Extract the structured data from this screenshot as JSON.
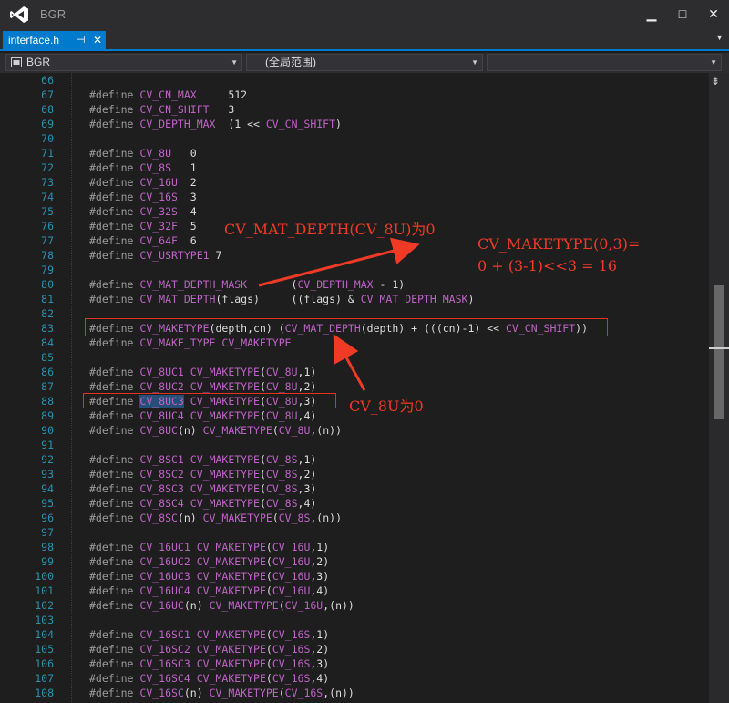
{
  "app": {
    "title": "BGR"
  },
  "window_controls": {
    "minimize": "▁",
    "maximize": "□",
    "close": "✕"
  },
  "tab": {
    "label": "interface.h",
    "pin": "⊣",
    "close": "✕",
    "menu": "▼"
  },
  "navbar": {
    "project": "BGR",
    "scope": "(全局范围)",
    "member": ""
  },
  "scrollbar": {
    "split_icon": "⇟"
  },
  "code_lines": [
    {
      "num": "66",
      "parts": []
    },
    {
      "num": "67",
      "parts": [
        [
          "kw",
          "#define "
        ],
        [
          "m",
          "CV_CN_MAX"
        ],
        [
          "p",
          "     512"
        ]
      ]
    },
    {
      "num": "68",
      "parts": [
        [
          "kw",
          "#define "
        ],
        [
          "m",
          "CV_CN_SHIFT"
        ],
        [
          "p",
          "   3"
        ]
      ]
    },
    {
      "num": "69",
      "parts": [
        [
          "kw",
          "#define "
        ],
        [
          "m",
          "CV_DEPTH_MAX"
        ],
        [
          "p",
          "  (1 << "
        ],
        [
          "m",
          "CV_CN_SHIFT"
        ],
        [
          "p",
          ")"
        ]
      ]
    },
    {
      "num": "70",
      "parts": []
    },
    {
      "num": "71",
      "parts": [
        [
          "kw",
          "#define "
        ],
        [
          "m",
          "CV_8U"
        ],
        [
          "p",
          "   0"
        ]
      ]
    },
    {
      "num": "72",
      "parts": [
        [
          "kw",
          "#define "
        ],
        [
          "m",
          "CV_8S"
        ],
        [
          "p",
          "   1"
        ]
      ]
    },
    {
      "num": "73",
      "parts": [
        [
          "kw",
          "#define "
        ],
        [
          "m",
          "CV_16U"
        ],
        [
          "p",
          "  2"
        ]
      ]
    },
    {
      "num": "74",
      "parts": [
        [
          "kw",
          "#define "
        ],
        [
          "m",
          "CV_16S"
        ],
        [
          "p",
          "  3"
        ]
      ]
    },
    {
      "num": "75",
      "parts": [
        [
          "kw",
          "#define "
        ],
        [
          "m",
          "CV_32S"
        ],
        [
          "p",
          "  4"
        ]
      ]
    },
    {
      "num": "76",
      "parts": [
        [
          "kw",
          "#define "
        ],
        [
          "m",
          "CV_32F"
        ],
        [
          "p",
          "  5"
        ]
      ]
    },
    {
      "num": "77",
      "parts": [
        [
          "kw",
          "#define "
        ],
        [
          "m",
          "CV_64F"
        ],
        [
          "p",
          "  6"
        ]
      ]
    },
    {
      "num": "78",
      "parts": [
        [
          "kw",
          "#define "
        ],
        [
          "m",
          "CV_USRTYPE1"
        ],
        [
          "p",
          " 7"
        ]
      ]
    },
    {
      "num": "79",
      "parts": []
    },
    {
      "num": "80",
      "parts": [
        [
          "kw",
          "#define "
        ],
        [
          "m",
          "CV_MAT_DEPTH_MASK"
        ],
        [
          "p",
          "       ("
        ],
        [
          "m",
          "CV_DEPTH_MAX"
        ],
        [
          "p",
          " - 1)"
        ]
      ]
    },
    {
      "num": "81",
      "parts": [
        [
          "kw",
          "#define "
        ],
        [
          "m",
          "CV_MAT_DEPTH"
        ],
        [
          "p",
          "(flags)     ((flags) & "
        ],
        [
          "m",
          "CV_MAT_DEPTH_MASK"
        ],
        [
          "p",
          ")"
        ]
      ]
    },
    {
      "num": "82",
      "parts": []
    },
    {
      "num": "83",
      "parts": [
        [
          "kw",
          "#define "
        ],
        [
          "m",
          "CV_MAKETYPE"
        ],
        [
          "p",
          "(depth,cn) ("
        ],
        [
          "m",
          "CV_MAT_DEPTH"
        ],
        [
          "p",
          "(depth) + (((cn)-1) << "
        ],
        [
          "m",
          "CV_CN_SHIFT"
        ],
        [
          "p",
          "))"
        ]
      ]
    },
    {
      "num": "84",
      "parts": [
        [
          "kw",
          "#define "
        ],
        [
          "m",
          "CV_MAKE_TYPE"
        ],
        [
          "p",
          " "
        ],
        [
          "m",
          "CV_MAKETYPE"
        ]
      ]
    },
    {
      "num": "85",
      "parts": []
    },
    {
      "num": "86",
      "parts": [
        [
          "kw",
          "#define "
        ],
        [
          "m",
          "CV_8UC1"
        ],
        [
          "p",
          " "
        ],
        [
          "m",
          "CV_MAKETYPE"
        ],
        [
          "p",
          "("
        ],
        [
          "m",
          "CV_8U"
        ],
        [
          "p",
          ",1)"
        ]
      ]
    },
    {
      "num": "87",
      "parts": [
        [
          "kw",
          "#define "
        ],
        [
          "m",
          "CV_8UC2"
        ],
        [
          "p",
          " "
        ],
        [
          "m",
          "CV_MAKETYPE"
        ],
        [
          "p",
          "("
        ],
        [
          "m",
          "CV_8U"
        ],
        [
          "p",
          ",2)"
        ]
      ]
    },
    {
      "num": "88",
      "parts": [
        [
          "kw",
          "#define "
        ],
        [
          "mh",
          "CV_8UC3"
        ],
        [
          "p",
          " "
        ],
        [
          "m",
          "CV_MAKETYPE"
        ],
        [
          "p",
          "("
        ],
        [
          "m",
          "CV_8U"
        ],
        [
          "p",
          ",3)"
        ]
      ]
    },
    {
      "num": "89",
      "parts": [
        [
          "kw",
          "#define "
        ],
        [
          "m",
          "CV_8UC4"
        ],
        [
          "p",
          " "
        ],
        [
          "m",
          "CV_MAKETYPE"
        ],
        [
          "p",
          "("
        ],
        [
          "m",
          "CV_8U"
        ],
        [
          "p",
          ",4)"
        ]
      ]
    },
    {
      "num": "90",
      "parts": [
        [
          "kw",
          "#define "
        ],
        [
          "m",
          "CV_8UC"
        ],
        [
          "p",
          "(n) "
        ],
        [
          "m",
          "CV_MAKETYPE"
        ],
        [
          "p",
          "("
        ],
        [
          "m",
          "CV_8U"
        ],
        [
          "p",
          ",(n))"
        ]
      ]
    },
    {
      "num": "91",
      "parts": []
    },
    {
      "num": "92",
      "parts": [
        [
          "kw",
          "#define "
        ],
        [
          "m",
          "CV_8SC1"
        ],
        [
          "p",
          " "
        ],
        [
          "m",
          "CV_MAKETYPE"
        ],
        [
          "p",
          "("
        ],
        [
          "m",
          "CV_8S"
        ],
        [
          "p",
          ",1)"
        ]
      ]
    },
    {
      "num": "93",
      "parts": [
        [
          "kw",
          "#define "
        ],
        [
          "m",
          "CV_8SC2"
        ],
        [
          "p",
          " "
        ],
        [
          "m",
          "CV_MAKETYPE"
        ],
        [
          "p",
          "("
        ],
        [
          "m",
          "CV_8S"
        ],
        [
          "p",
          ",2)"
        ]
      ]
    },
    {
      "num": "94",
      "parts": [
        [
          "kw",
          "#define "
        ],
        [
          "m",
          "CV_8SC3"
        ],
        [
          "p",
          " "
        ],
        [
          "m",
          "CV_MAKETYPE"
        ],
        [
          "p",
          "("
        ],
        [
          "m",
          "CV_8S"
        ],
        [
          "p",
          ",3)"
        ]
      ]
    },
    {
      "num": "95",
      "parts": [
        [
          "kw",
          "#define "
        ],
        [
          "m",
          "CV_8SC4"
        ],
        [
          "p",
          " "
        ],
        [
          "m",
          "CV_MAKETYPE"
        ],
        [
          "p",
          "("
        ],
        [
          "m",
          "CV_8S"
        ],
        [
          "p",
          ",4)"
        ]
      ]
    },
    {
      "num": "96",
      "parts": [
        [
          "kw",
          "#define "
        ],
        [
          "m",
          "CV_8SC"
        ],
        [
          "p",
          "(n) "
        ],
        [
          "m",
          "CV_MAKETYPE"
        ],
        [
          "p",
          "("
        ],
        [
          "m",
          "CV_8S"
        ],
        [
          "p",
          ",(n))"
        ]
      ]
    },
    {
      "num": "97",
      "parts": []
    },
    {
      "num": "98",
      "parts": [
        [
          "kw",
          "#define "
        ],
        [
          "m",
          "CV_16UC1"
        ],
        [
          "p",
          " "
        ],
        [
          "m",
          "CV_MAKETYPE"
        ],
        [
          "p",
          "("
        ],
        [
          "m",
          "CV_16U"
        ],
        [
          "p",
          ",1)"
        ]
      ]
    },
    {
      "num": "99",
      "parts": [
        [
          "kw",
          "#define "
        ],
        [
          "m",
          "CV_16UC2"
        ],
        [
          "p",
          " "
        ],
        [
          "m",
          "CV_MAKETYPE"
        ],
        [
          "p",
          "("
        ],
        [
          "m",
          "CV_16U"
        ],
        [
          "p",
          ",2)"
        ]
      ]
    },
    {
      "num": "100",
      "parts": [
        [
          "kw",
          "#define "
        ],
        [
          "m",
          "CV_16UC3"
        ],
        [
          "p",
          " "
        ],
        [
          "m",
          "CV_MAKETYPE"
        ],
        [
          "p",
          "("
        ],
        [
          "m",
          "CV_16U"
        ],
        [
          "p",
          ",3)"
        ]
      ]
    },
    {
      "num": "101",
      "parts": [
        [
          "kw",
          "#define "
        ],
        [
          "m",
          "CV_16UC4"
        ],
        [
          "p",
          " "
        ],
        [
          "m",
          "CV_MAKETYPE"
        ],
        [
          "p",
          "("
        ],
        [
          "m",
          "CV_16U"
        ],
        [
          "p",
          ",4)"
        ]
      ]
    },
    {
      "num": "102",
      "parts": [
        [
          "kw",
          "#define "
        ],
        [
          "m",
          "CV_16UC"
        ],
        [
          "p",
          "(n) "
        ],
        [
          "m",
          "CV_MAKETYPE"
        ],
        [
          "p",
          "("
        ],
        [
          "m",
          "CV_16U"
        ],
        [
          "p",
          ",(n))"
        ]
      ]
    },
    {
      "num": "103",
      "parts": []
    },
    {
      "num": "104",
      "parts": [
        [
          "kw",
          "#define "
        ],
        [
          "m",
          "CV_16SC1"
        ],
        [
          "p",
          " "
        ],
        [
          "m",
          "CV_MAKETYPE"
        ],
        [
          "p",
          "("
        ],
        [
          "m",
          "CV_16S"
        ],
        [
          "p",
          ",1)"
        ]
      ]
    },
    {
      "num": "105",
      "parts": [
        [
          "kw",
          "#define "
        ],
        [
          "m",
          "CV_16SC2"
        ],
        [
          "p",
          " "
        ],
        [
          "m",
          "CV_MAKETYPE"
        ],
        [
          "p",
          "("
        ],
        [
          "m",
          "CV_16S"
        ],
        [
          "p",
          ",2)"
        ]
      ]
    },
    {
      "num": "106",
      "parts": [
        [
          "kw",
          "#define "
        ],
        [
          "m",
          "CV_16SC3"
        ],
        [
          "p",
          " "
        ],
        [
          "m",
          "CV_MAKETYPE"
        ],
        [
          "p",
          "("
        ],
        [
          "m",
          "CV_16S"
        ],
        [
          "p",
          ",3)"
        ]
      ]
    },
    {
      "num": "107",
      "parts": [
        [
          "kw",
          "#define "
        ],
        [
          "m",
          "CV_16SC4"
        ],
        [
          "p",
          " "
        ],
        [
          "m",
          "CV_MAKETYPE"
        ],
        [
          "p",
          "("
        ],
        [
          "m",
          "CV_16S"
        ],
        [
          "p",
          ",4)"
        ]
      ]
    },
    {
      "num": "108",
      "parts": [
        [
          "kw",
          "#define "
        ],
        [
          "m",
          "CV_16SC"
        ],
        [
          "p",
          "(n) "
        ],
        [
          "m",
          "CV_MAKETYPE"
        ],
        [
          "p",
          "("
        ],
        [
          "m",
          "CV_16S"
        ],
        [
          "p",
          ",(n))"
        ]
      ]
    }
  ],
  "annotations": {
    "mat_depth_note": "CV_MAT_DEPTH(CV_8U)为0",
    "maketype_note_line1": "CV_MAKETYPE(0,3)=",
    "maketype_note_line2": "0 + (3-1)<<3 = 16",
    "cv8u_note": "CV_8U为0",
    "color": "#f03a26"
  },
  "colors": {
    "editor_bg": "#1e1e1e",
    "line_number": "#2b91af",
    "macro": "#bd63c5",
    "accent": "#007acc"
  }
}
